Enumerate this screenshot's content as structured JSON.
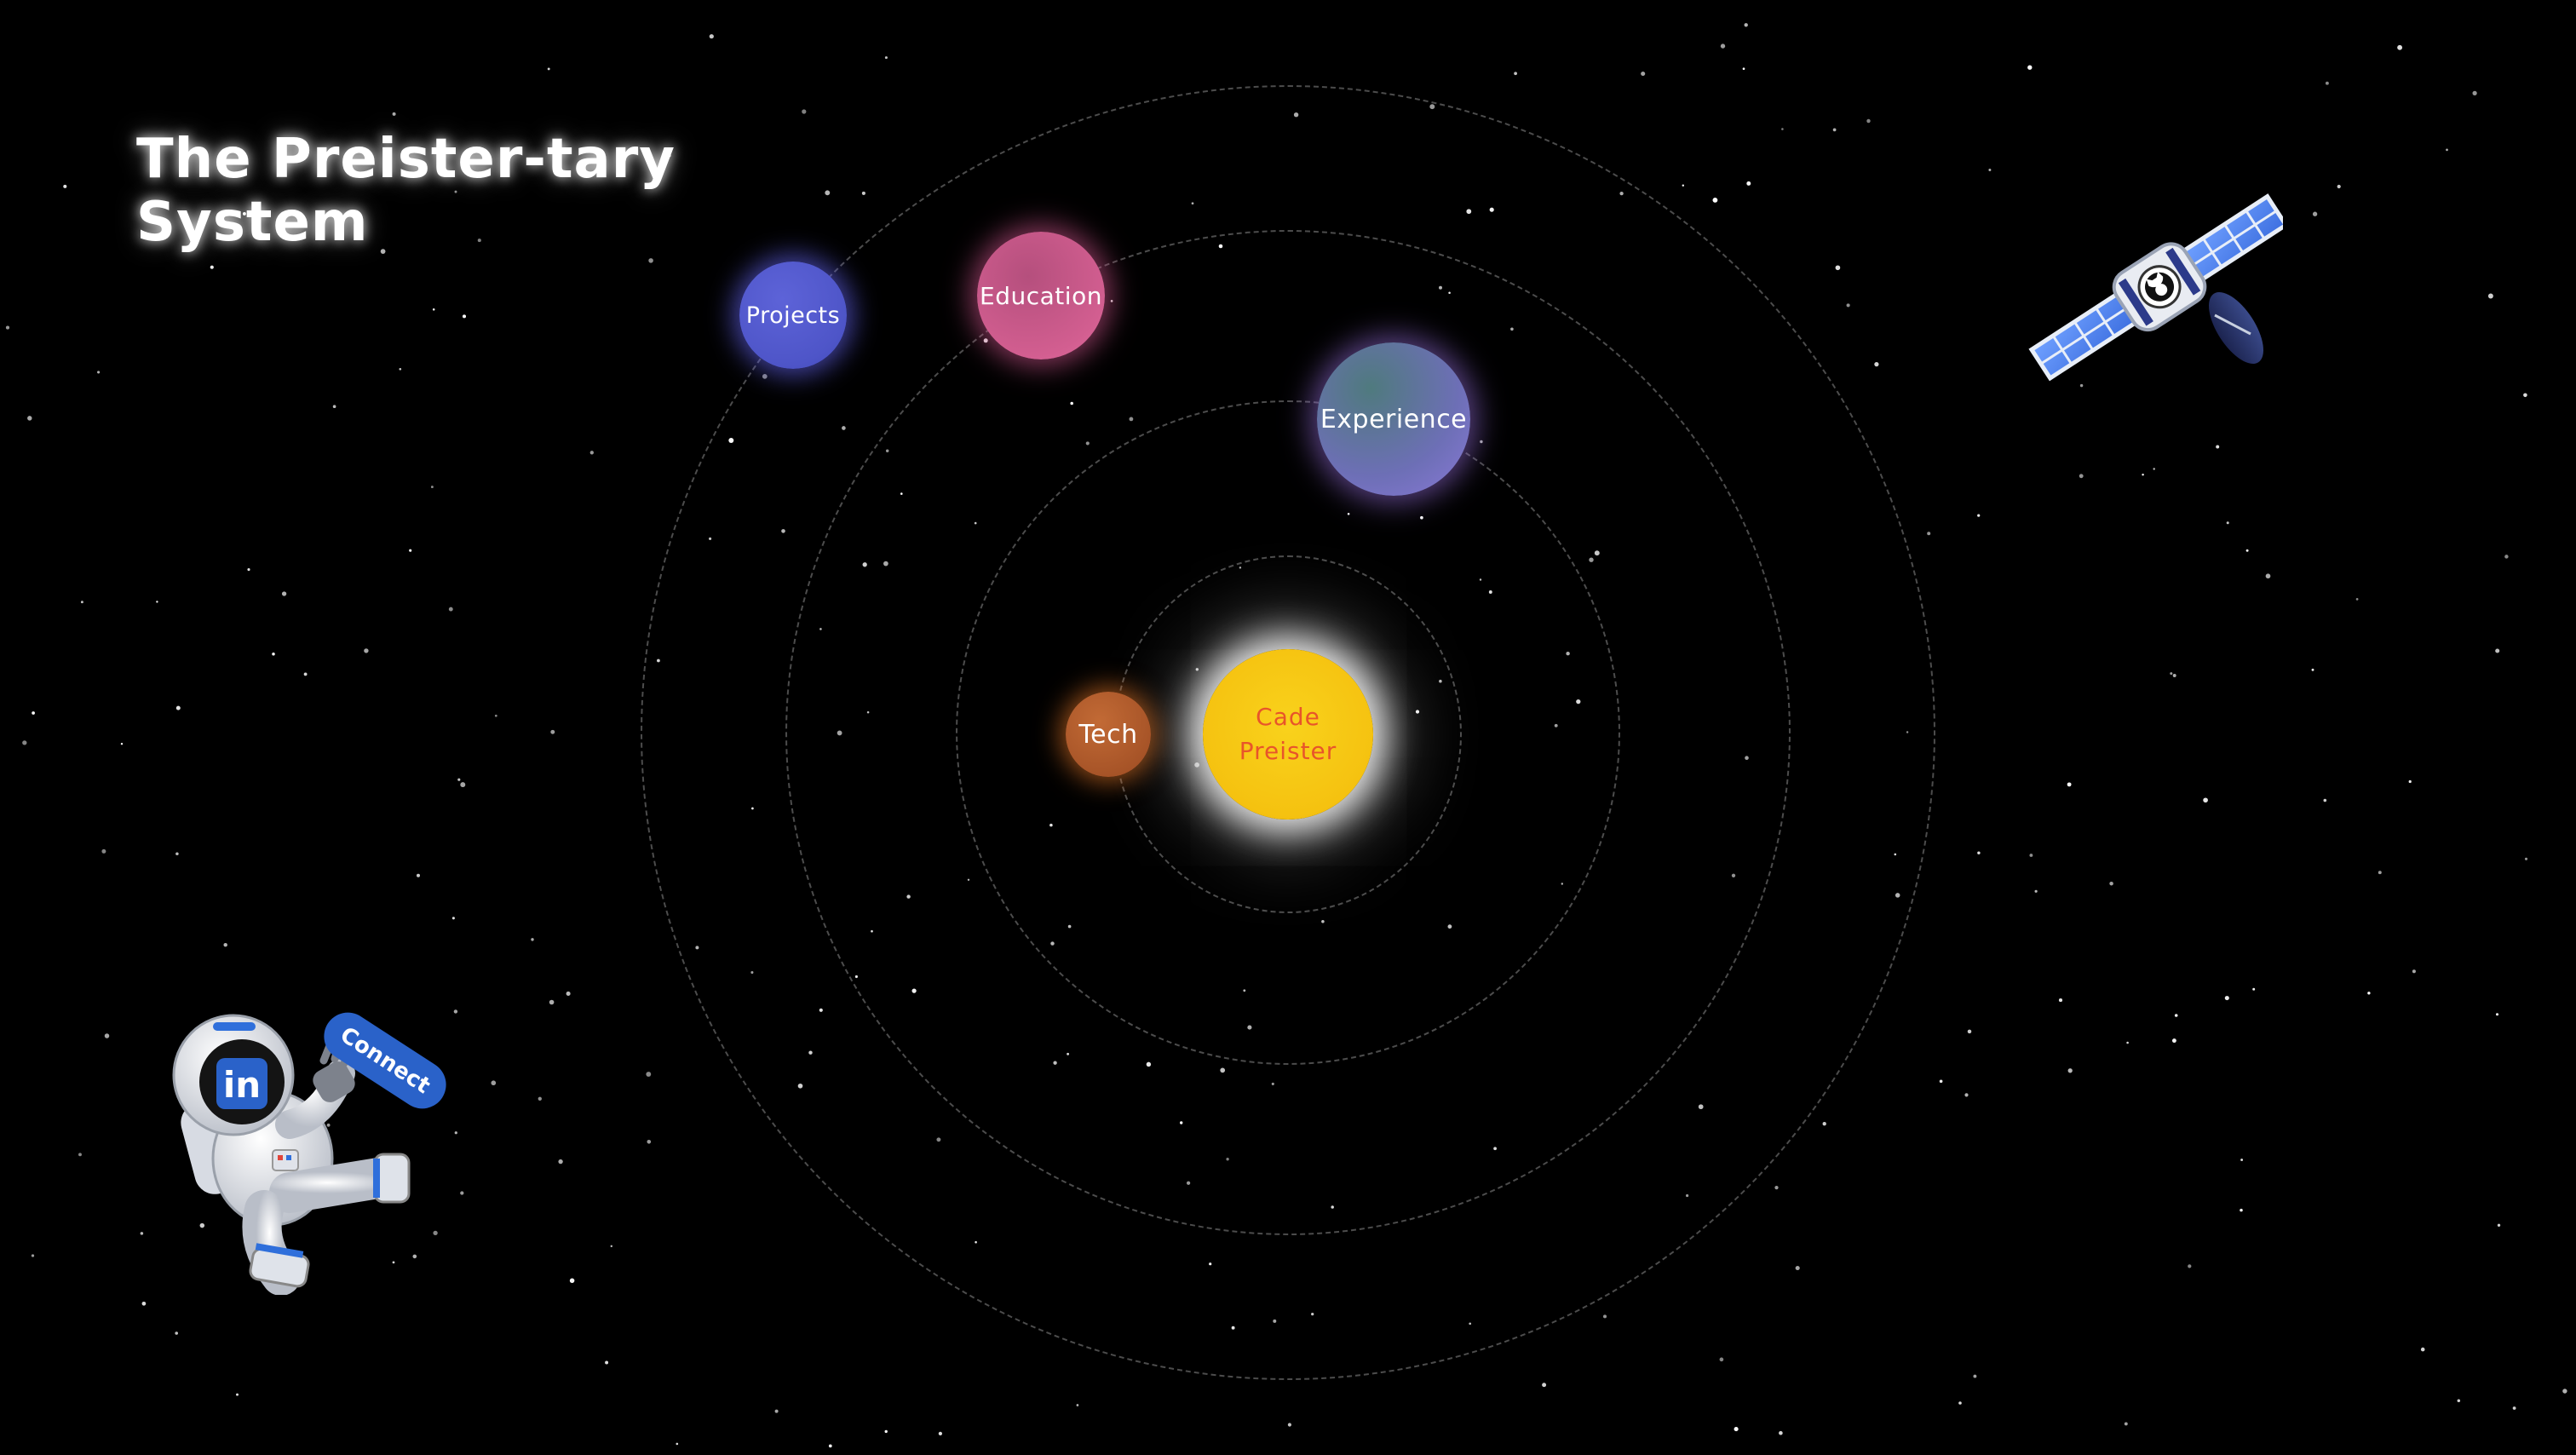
{
  "header": {
    "title_line1": "The Preister-tary",
    "title_line2": "System"
  },
  "sun": {
    "name_line1": "Cade",
    "name_line2": "Preister"
  },
  "planets": {
    "tech": "Tech",
    "experience": "Experience",
    "education": "Education",
    "projects": "Projects"
  },
  "social": {
    "connect_label": "Connect",
    "linkedin_badge": "in"
  },
  "icons": {
    "satellite": "github-satellite-icon",
    "astronaut": "linkedin-astronaut-icon"
  },
  "colors": {
    "background": "#000000",
    "sun": "#f5c210",
    "sun_text": "#e8552a",
    "tech": "#b05a2c",
    "experience": "#6d6fb6",
    "education": "#d25e90",
    "projects": "#4e55c8",
    "connect": "#2a62c9"
  }
}
